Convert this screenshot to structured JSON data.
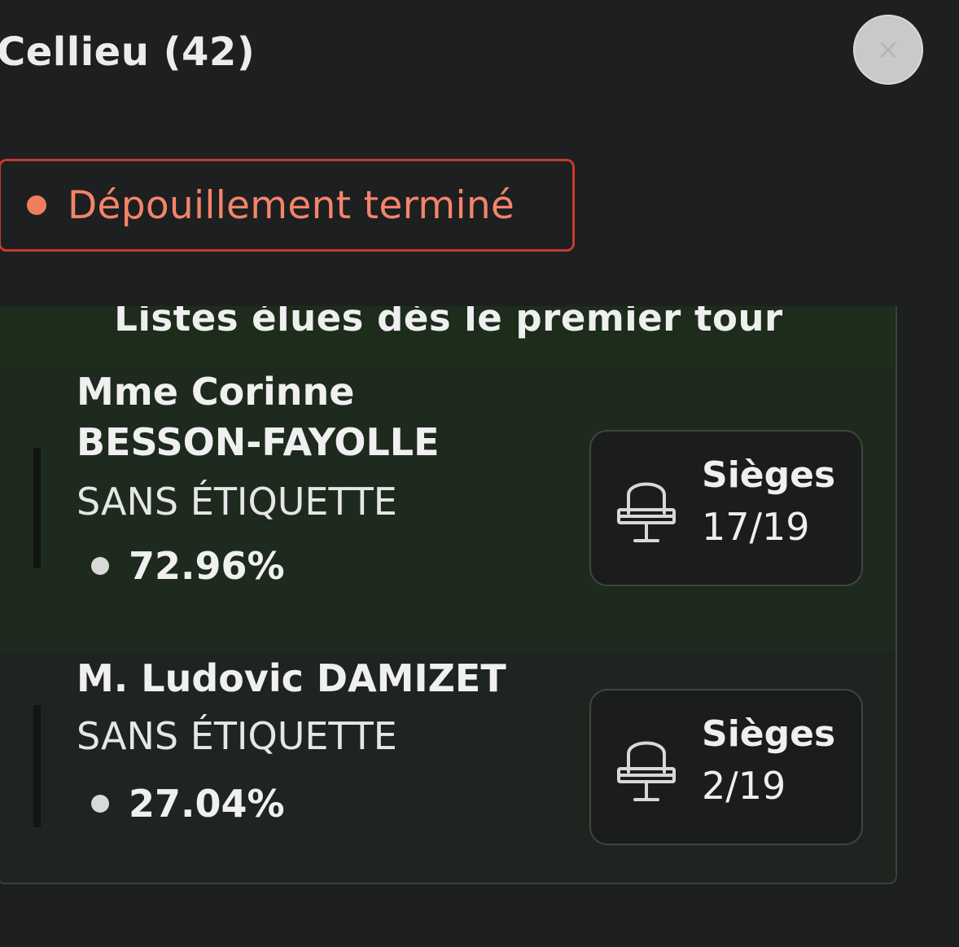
{
  "commune": {
    "title": "Cellieu (42)"
  },
  "close_button": {
    "symbol": "×"
  },
  "status": {
    "label": "Dépouillement terminé",
    "color": "#f3846a",
    "border_color": "#c83a2f"
  },
  "results": {
    "header": "Listes élues dès le premier tour",
    "candidates": [
      {
        "name": "Mme Corinne BESSON-FAYOLLE",
        "party": "SANS ÉTIQUETTE",
        "percentage": "72.96%",
        "seats_label": "Sièges",
        "seats_value": "17/19",
        "icon": "chair-icon"
      },
      {
        "name": "M. Ludovic DAMIZET",
        "party": "SANS ÉTIQUETTE",
        "percentage": "27.04%",
        "seats_label": "Sièges",
        "seats_value": "2/19",
        "icon": "chair-icon"
      }
    ]
  }
}
